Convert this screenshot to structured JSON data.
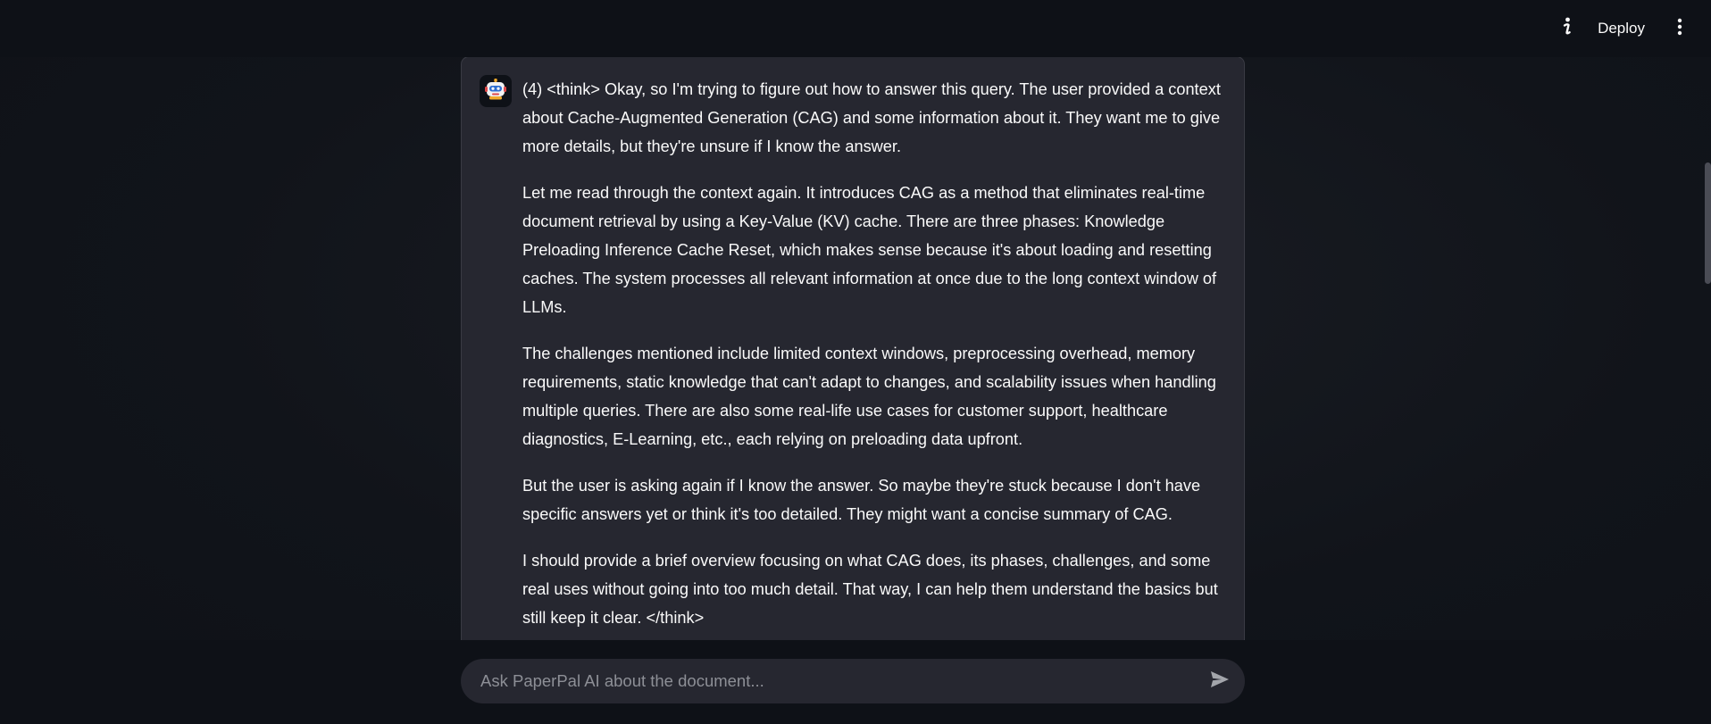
{
  "header": {
    "info_icon": "info-icon",
    "deploy_label": "Deploy",
    "menu_icon": "kebab-menu-icon"
  },
  "chat": {
    "messages": [
      {
        "role": "assistant",
        "avatar_icon": "robot-icon",
        "paragraphs": [
          "(4) <think> Okay, so I'm trying to figure out how to answer this query. The user provided a context about Cache-Augmented Generation (CAG) and some information about it. They want me to give more details, but they're unsure if I know the answer.",
          "Let me read through the context again. It introduces CAG as a method that eliminates real-time document retrieval by using a Key-Value (KV) cache. There are three phases: Knowledge Preloading Inference Cache Reset, which makes sense because it's about loading and resetting caches. The system processes all relevant information at once due to the long context window of LLMs.",
          "The challenges mentioned include limited context windows, preprocessing overhead, memory requirements, static knowledge that can't adapt to changes, and scalability issues when handling multiple queries. There are also some real-life use cases for customer support, healthcare diagnostics, E-Learning, etc., each relying on preloading data upfront.",
          "But the user is asking again if I know the answer. So maybe they're stuck because I don't have specific answers yet or think it's too detailed. They might want a concise summary of CAG.",
          "I should provide a brief overview focusing on what CAG does, its phases, challenges, and some real uses without going into too much detail. That way, I can help them understand the basics but still keep it clear. </think>"
        ]
      }
    ]
  },
  "input": {
    "placeholder": "Ask PaperPal AI about the document...",
    "value": "",
    "send_icon": "send-icon"
  },
  "colors": {
    "background": "#0e1117",
    "message_bg": "#262730",
    "text": "#fafafa",
    "placeholder": "#8d8f96"
  }
}
